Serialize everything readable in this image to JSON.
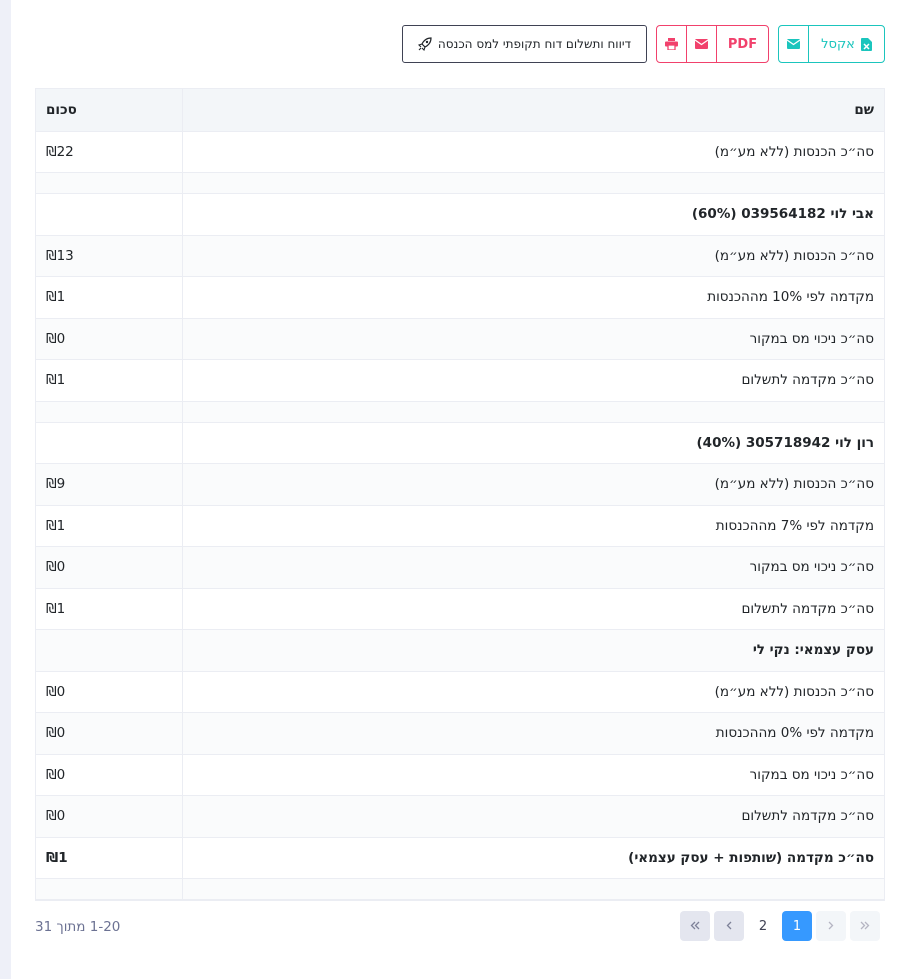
{
  "toolbar": {
    "excel_label": "אקסל",
    "pdf_label": "PDF",
    "report_label": "דיווח ותשלום דוח תקופתי למס הכנסה"
  },
  "table": {
    "headers": {
      "name": "שם",
      "amount": "סכום"
    },
    "rows": [
      {
        "name": "סה״כ הכנסות (ללא מע״מ)",
        "amount": "₪22",
        "bold": false
      },
      {
        "name": "",
        "amount": "",
        "spacer": true
      },
      {
        "name": "אבי לוי 039564182 (60%)",
        "amount": "",
        "bold": true
      },
      {
        "name": "סה״כ הכנסות (ללא מע״מ)",
        "amount": "₪13",
        "bold": false
      },
      {
        "name": "מקדמה לפי 10% מההכנסות",
        "amount": "₪1",
        "bold": false
      },
      {
        "name": "סה״כ ניכוי מס במקור",
        "amount": "₪0",
        "bold": false
      },
      {
        "name": "סה״כ מקדמה לתשלום",
        "amount": "₪1",
        "bold": false
      },
      {
        "name": "",
        "amount": "",
        "spacer": true
      },
      {
        "name": "רון לוי 305718942 (40%)",
        "amount": "",
        "bold": true
      },
      {
        "name": "סה״כ הכנסות (ללא מע״מ)",
        "amount": "₪9",
        "bold": false
      },
      {
        "name": "מקדמה לפי 7% מההכנסות",
        "amount": "₪1",
        "bold": false
      },
      {
        "name": "סה״כ ניכוי מס במקור",
        "amount": "₪0",
        "bold": false
      },
      {
        "name": "סה״כ מקדמה לתשלום",
        "amount": "₪1",
        "bold": false
      },
      {
        "name": "עסק עצמאי: נקי לי",
        "amount": "",
        "bold": true
      },
      {
        "name": "סה״כ הכנסות (ללא מע״מ)",
        "amount": "₪0",
        "bold": false
      },
      {
        "name": "מקדמה לפי 0% מההכנסות",
        "amount": "₪0",
        "bold": false
      },
      {
        "name": "סה״כ ניכוי מס במקור",
        "amount": "₪0",
        "bold": false
      },
      {
        "name": "סה״כ מקדמה לתשלום",
        "amount": "₪0",
        "bold": false
      },
      {
        "name": "סה״כ מקדמה (שותפות + עסק עצמאי)",
        "amount": "₪1",
        "bold": true
      },
      {
        "name": "",
        "amount": "",
        "spacer": true
      }
    ]
  },
  "pagination": {
    "pages": [
      "1",
      "2"
    ],
    "active": "1",
    "range_text": "1-20 מתוך 31"
  },
  "colors": {
    "accent_green": "#1bc5bd",
    "accent_pink": "#f1416c",
    "active_page": "#3699ff"
  },
  "icons": [
    "file-excel-icon",
    "envelope-icon",
    "printer-icon",
    "rocket-icon",
    "chevron-left-icon",
    "chevron-right-icon",
    "double-chevron-left-icon",
    "double-chevron-right-icon"
  ]
}
